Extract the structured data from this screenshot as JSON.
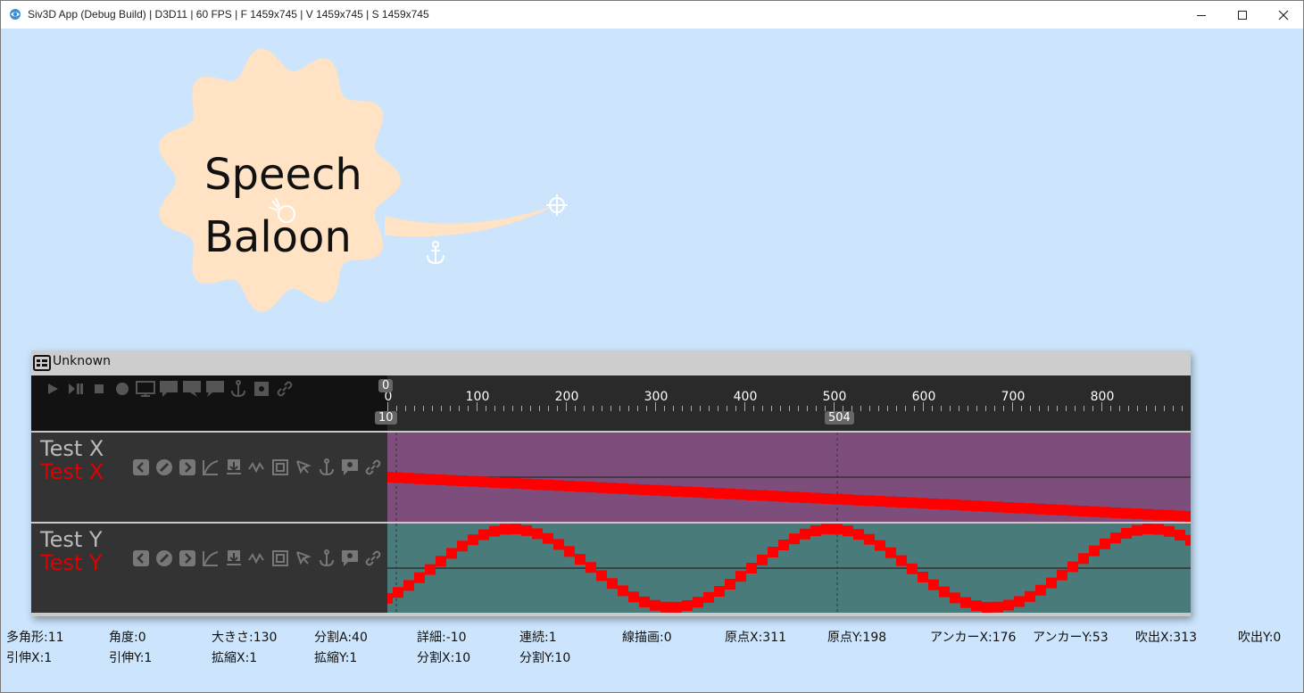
{
  "window": {
    "title": "Siv3D App (Debug Build) | D3D11 | 60 FPS | F 1459x745 | V 1459x745 | S 1459x745",
    "bg_color": "#cce5fc"
  },
  "balloon": {
    "line1": "Speech",
    "line2": "Baloon",
    "fill_color": "#ffe3c4"
  },
  "timeline": {
    "title": "Unknown",
    "ruler_labels": [
      "0",
      "100",
      "200",
      "300",
      "400",
      "500",
      "600",
      "700",
      "800"
    ],
    "cursor_top": "0",
    "cursor_bottom_left": "10",
    "cursor_bottom_right": "504",
    "tracks": [
      {
        "name": "Test X",
        "name_active": "Test X",
        "color": "#7d4d7c"
      },
      {
        "name": "Test Y",
        "name_active": "Test Y",
        "color": "#4a7b7b"
      }
    ]
  },
  "status": {
    "row1": [
      "多角形:11",
      "角度:0",
      "大きさ:130",
      "分割A:40",
      "詳細:-10",
      "連続:1",
      "線描画:0",
      "原点X:311",
      "原点Y:198",
      "アンカーX:176",
      "アンカーY:53",
      "吹出X:313",
      "吹出Y:0"
    ],
    "row2": [
      "引伸X:1",
      "引伸Y:1",
      "拡縮X:1",
      "拡縮Y:1",
      "分割X:10",
      "分割Y:10"
    ]
  }
}
